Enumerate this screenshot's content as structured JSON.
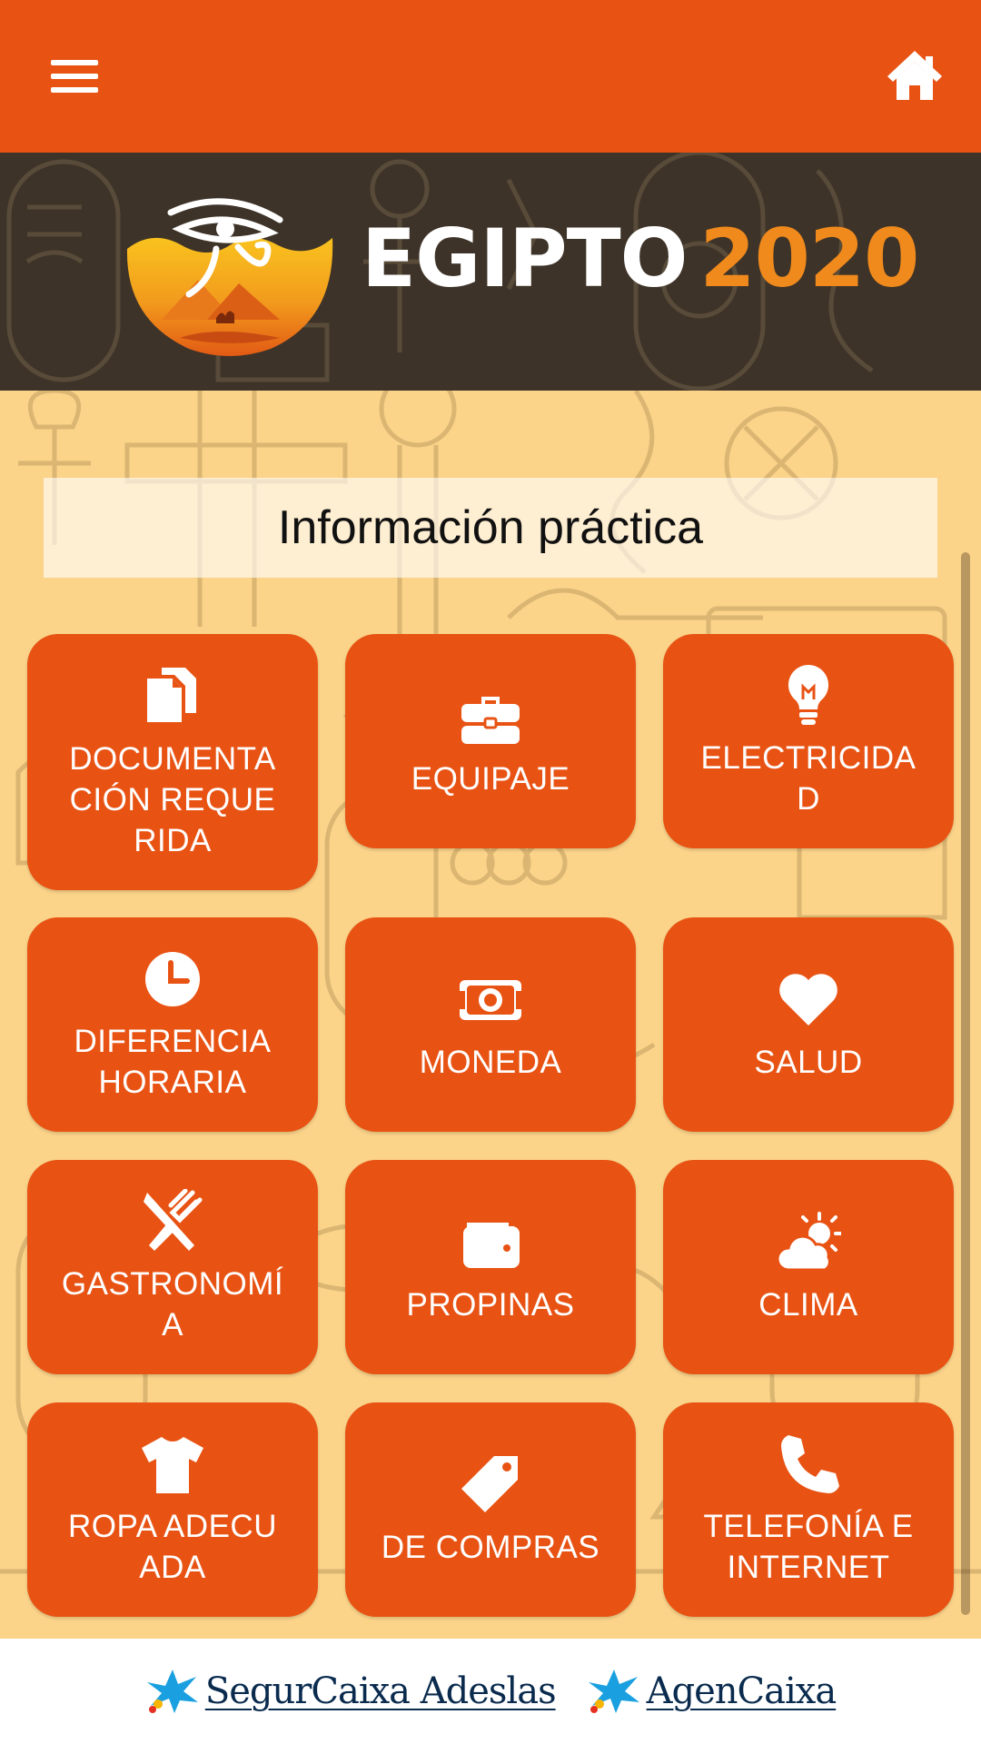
{
  "colors": {
    "accent": "#e85314",
    "banner_dark": "#3e3328",
    "background": "#fbd389",
    "title_year": "#f08a1c",
    "sponsor_blue": "#0a2b4e",
    "star_blue": "#1aa0e0"
  },
  "header": {
    "menu_icon": "hamburger-menu-icon",
    "home_icon": "home-icon"
  },
  "banner": {
    "title_word": "EGIPTO",
    "title_year": "2020",
    "logo_icon": "eye-of-horus-logo"
  },
  "section": {
    "title": "Información práctica"
  },
  "tiles": [
    {
      "label": "DOCUMENTACIÓN REQUERIDA",
      "icon": "documents-icon"
    },
    {
      "label": "EQUIPAJE",
      "icon": "briefcase-icon"
    },
    {
      "label": "ELECTRICIDAD",
      "icon": "lightbulb-icon"
    },
    {
      "label": "DIFERENCIA HORARIA",
      "icon": "clock-icon"
    },
    {
      "label": "MONEDA",
      "icon": "money-icon"
    },
    {
      "label": "SALUD",
      "icon": "heart-icon"
    },
    {
      "label": "GASTRONOMÍA",
      "icon": "utensils-icon"
    },
    {
      "label": "PROPINAS",
      "icon": "wallet-icon"
    },
    {
      "label": "CLIMA",
      "icon": "cloud-sun-icon"
    },
    {
      "label": "ROPA ADECUADA",
      "icon": "tshirt-icon"
    },
    {
      "label": "DE COMPRAS",
      "icon": "tag-icon"
    },
    {
      "label": "TELEFONÍA E INTERNET",
      "icon": "phone-icon"
    }
  ],
  "footer": {
    "sponsors": [
      {
        "name": "SegurCaixa Adeslas",
        "icon": "caixa-star-icon"
      },
      {
        "name": "AgenCaixa",
        "icon": "caixa-star-icon"
      }
    ]
  }
}
